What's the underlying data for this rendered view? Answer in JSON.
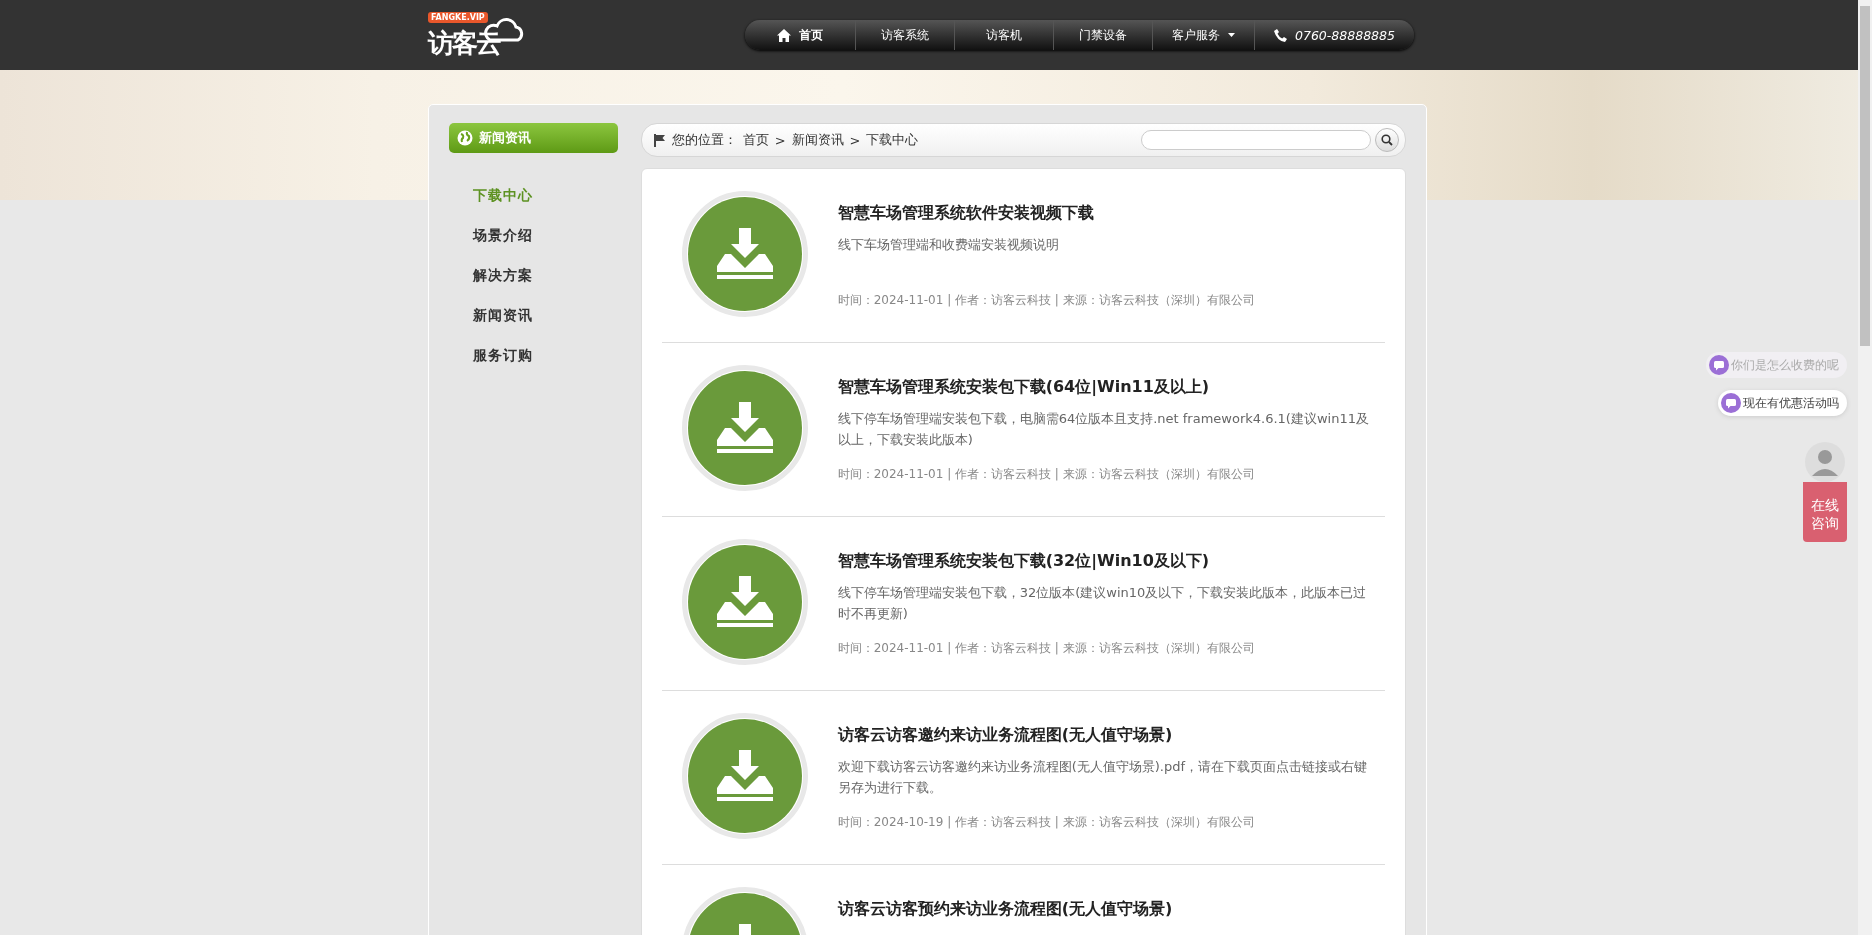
{
  "logo": {
    "badge": "FANGKE.VIP",
    "text": "访客云"
  },
  "nav": [
    {
      "label": "首页",
      "kind": "home",
      "selected": true
    },
    {
      "label": "访客系统",
      "kind": "plain",
      "selected": false
    },
    {
      "label": "访客机",
      "kind": "plain",
      "selected": false
    },
    {
      "label": "门禁设备",
      "kind": "plain",
      "selected": false
    },
    {
      "label": "客户服务",
      "kind": "dropdown",
      "selected": false
    },
    {
      "label": "0760-88888885",
      "kind": "phone",
      "selected": false
    }
  ],
  "sidebar": {
    "title": "新闻资讯",
    "items": [
      {
        "label": "下载中心",
        "selected": true
      },
      {
        "label": "场景介绍",
        "selected": false
      },
      {
        "label": "解决方案",
        "selected": false
      },
      {
        "label": "新闻资讯",
        "selected": false
      },
      {
        "label": "服务订购",
        "selected": false
      }
    ]
  },
  "breadcrumb": {
    "prefix": "您的位置：",
    "items": [
      "首页",
      "新闻资讯",
      "下载中心"
    ],
    "separator": ">"
  },
  "articles": [
    {
      "title": "智慧车场管理系统软件安装视频下载",
      "summary": "线下车场管理端和收费端安装视频说明",
      "meta": "时间：2024-11-01 | 作者：访客云科技 | 来源：访客云科技（深圳）有限公司"
    },
    {
      "title": "智慧车场管理系统安装包下载(64位|Win11及以上)",
      "summary": "线下停车场管理端安装包下载，电脑需64位版本且支持.net framework4.6.1(建议win11及以上，下载安装此版本)",
      "meta": "时间：2024-11-01 | 作者：访客云科技 | 来源：访客云科技（深圳）有限公司"
    },
    {
      "title": "智慧车场管理系统安装包下载(32位|Win10及以下)",
      "summary": "线下停车场管理端安装包下载，32位版本(建议win10及以下，下载安装此版本，此版本已过时不再更新)",
      "meta": "时间：2024-11-01 | 作者：访客云科技 | 来源：访客云科技（深圳）有限公司"
    },
    {
      "title": "访客云访客邀约来访业务流程图(无人值守场景)",
      "summary": "欢迎下载访客云访客邀约来访业务流程图(无人值守场景).pdf，请在下载页面点击链接或右键另存为进行下载。",
      "meta": "时间：2024-10-19 | 作者：访客云科技 | 来源：访客云科技（深圳）有限公司"
    },
    {
      "title": "访客云访客预约来访业务流程图(无人值守场景)"
    }
  ],
  "chat": {
    "questions": [
      {
        "text": "你们是怎么收费的呢",
        "selected": false
      },
      {
        "text": "现在有优惠活动吗",
        "selected": true
      }
    ],
    "consult": "在线咨询"
  }
}
